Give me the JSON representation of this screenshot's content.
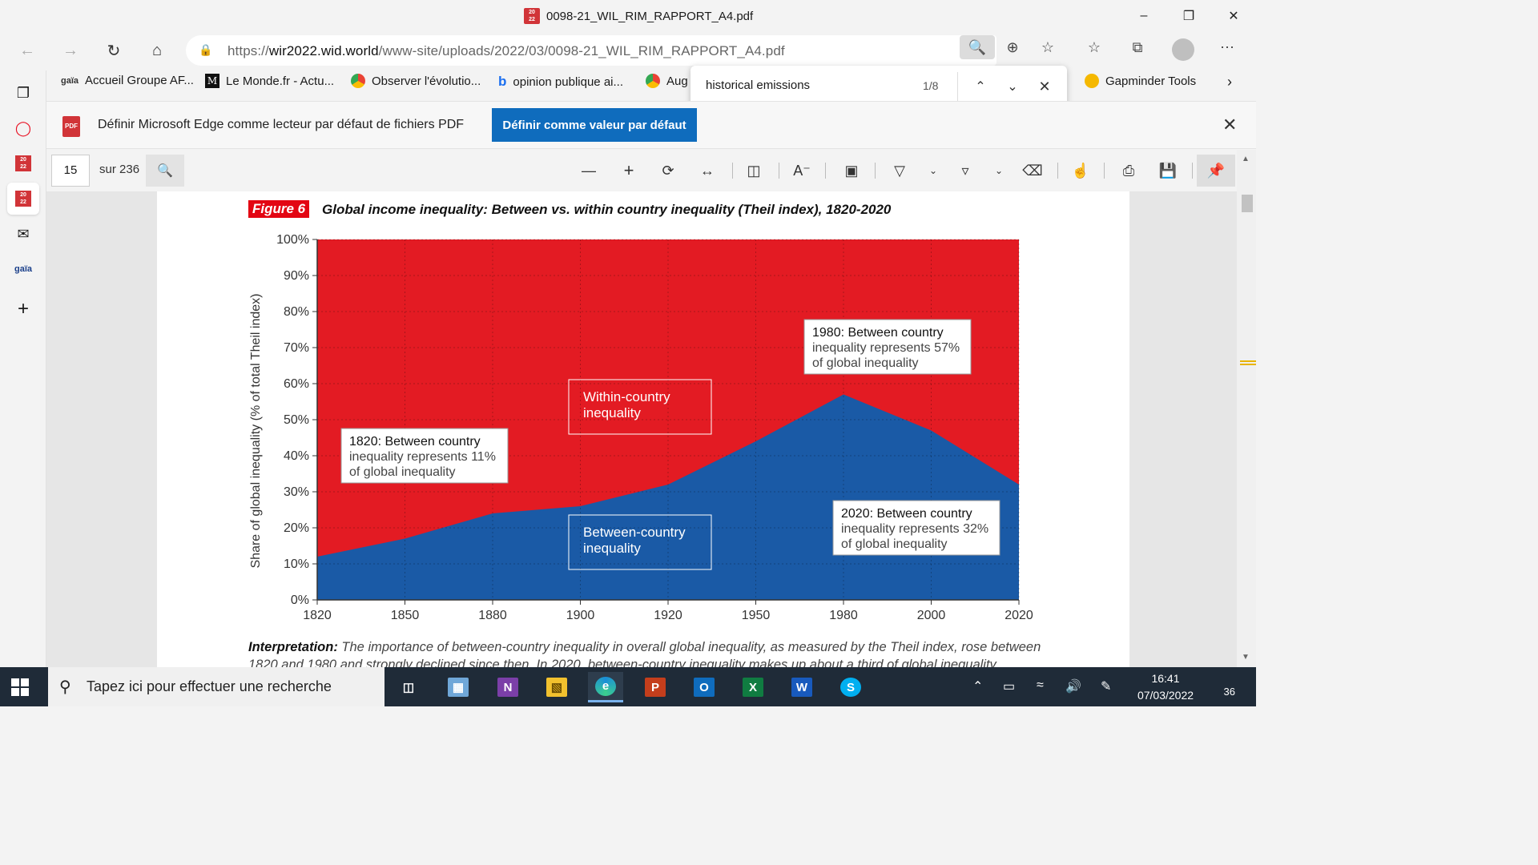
{
  "window": {
    "title": "0098-21_WIL_RIM_RAPPORT_A4.pdf",
    "tab_icon_text": "20 22"
  },
  "address": {
    "url_prefix": "https://",
    "url_domain": "wir2022.wid.world",
    "url_path": "/www-site/uploads/2022/03/0098-21_WIL_RIM_RAPPORT_A4.pdf"
  },
  "favorites": [
    {
      "label": "Accueil Groupe AF...",
      "icon": "gaia-icon"
    },
    {
      "label": "Le Monde.fr - Actu...",
      "icon": "le-monde-icon"
    },
    {
      "label": "Observer l'évolutio...",
      "icon": "chrome-icon"
    },
    {
      "label": "opinion publique ai...",
      "icon": "bing-icon"
    },
    {
      "label": "Aug",
      "icon": "chrome-icon"
    },
    {
      "label": "Gapminder Tools",
      "icon": "gapminder-icon"
    }
  ],
  "findbar": {
    "query": "historical emissions",
    "count": "1/8"
  },
  "notification": {
    "text": "Définir Microsoft Edge comme lecteur par défaut de fichiers PDF",
    "button": "Définir comme valeur par défaut",
    "badge": "PDF"
  },
  "pdf_toolbar": {
    "page": "15",
    "total": "sur 236"
  },
  "figure": {
    "label": "Figure 6",
    "title": "Global income inequality: Between vs. within country inequality (Theil index), 1820-2020",
    "interpretation_label": "Interpretation:",
    "interpretation_text": " The importance of between-country inequality in overall global inequality, as measured by the Theil index, rose between 1820 and 1980 and strongly declined since then. In 2020, between-country inequality makes up about a third of global inequality."
  },
  "chart_data": {
    "type": "area",
    "ylabel": "Share of global inequality (% of total Theil index)",
    "x": [
      "1820",
      "1850",
      "1880",
      "1900",
      "1920",
      "1950",
      "1980",
      "2000",
      "2020"
    ],
    "yticks": [
      "0%",
      "10%",
      "20%",
      "30%",
      "40%",
      "50%",
      "60%",
      "70%",
      "80%",
      "90%",
      "100%"
    ],
    "ylim": [
      0,
      100
    ],
    "grid": true,
    "series": [
      {
        "name": "Between-country inequality",
        "values": [
          12,
          17,
          24,
          26,
          32,
          44,
          57,
          47,
          32
        ],
        "color": "#1a5aa6"
      },
      {
        "name": "Within-country inequality",
        "values": [
          88,
          83,
          76,
          74,
          68,
          56,
          43,
          53,
          68
        ],
        "color": "#e31b23"
      }
    ],
    "annotations": [
      {
        "bold": "1820: Between country",
        "rest": [
          "inequality represents 11%",
          "of global inequality"
        ]
      },
      {
        "bold": "1980: Between country",
        "rest": [
          "inequality represents 57%",
          "of global inequality"
        ]
      },
      {
        "bold": "2020: Between country",
        "rest": [
          "inequality represents 32%",
          "of global inequality"
        ]
      }
    ],
    "series_labels": [
      [
        "Within-country",
        "inequality"
      ],
      [
        "Between-country",
        "inequality"
      ]
    ]
  },
  "taskbar": {
    "search_placeholder": "Tapez ici pour effectuer une recherche",
    "time": "16:41",
    "date": "07/03/2022",
    "notifications": "36"
  }
}
